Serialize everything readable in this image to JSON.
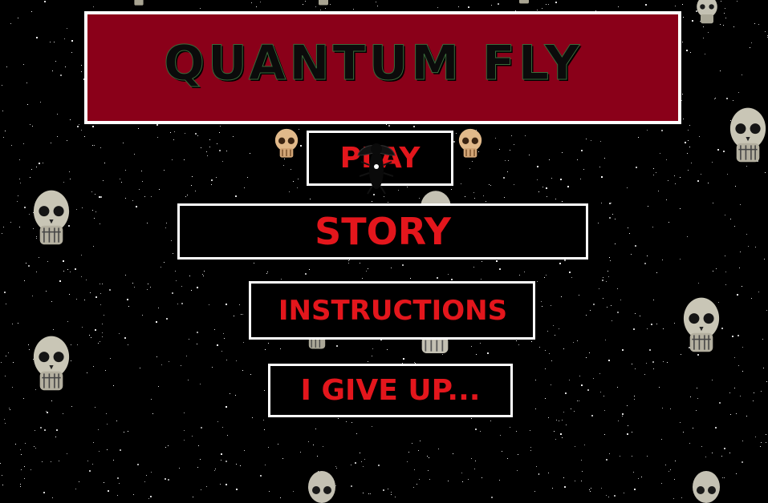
{
  "game": {
    "title": "QUANTUM FLY"
  },
  "menu": {
    "play_label": "PLAY",
    "story_label": "STORY",
    "instructions_label": "INSTRUCTIONS",
    "give_up_label": "I GIVE UP..."
  },
  "colors": {
    "background": "#000000",
    "banner": "#8a0019",
    "button_text": "#e3161c",
    "border": "#ffffff"
  },
  "icons": {
    "skull": "skull-icon",
    "fly": "fly-icon"
  }
}
